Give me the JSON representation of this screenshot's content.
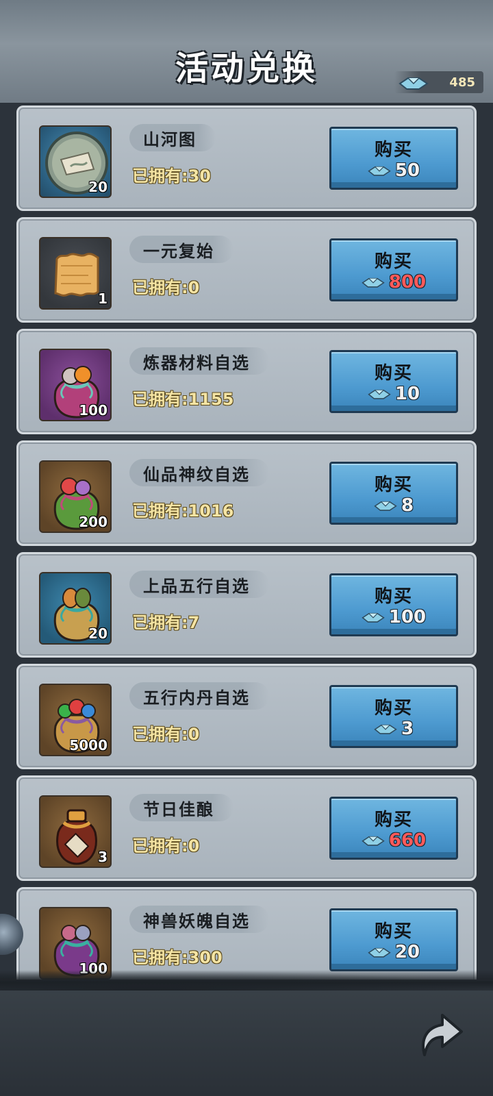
{
  "header": {
    "title": "活动兑换",
    "currency_icon": "gem-boat-icon",
    "currency_value": "485"
  },
  "buy_label": "购买",
  "items": [
    {
      "name": "山河图",
      "owned": "已拥有:30",
      "count": "20",
      "price": "50",
      "price_color": "#f2f2f2",
      "icon": "scroll-orb-icon",
      "frame": "blue"
    },
    {
      "name": "一元复始",
      "owned": "已拥有:0",
      "count": "1",
      "price": "800",
      "price_color": "#ff5a5a",
      "icon": "parchment-icon",
      "frame": "dark"
    },
    {
      "name": "炼器材料自选",
      "owned": "已拥有:1155",
      "count": "100",
      "price": "10",
      "price_color": "#f2f2f2",
      "icon": "purple-bag-icon",
      "frame": "purple"
    },
    {
      "name": "仙品神纹自选",
      "owned": "已拥有:1016",
      "count": "200",
      "price": "8",
      "price_color": "#f2f2f2",
      "icon": "green-bag-icon",
      "frame": "brown"
    },
    {
      "name": "上品五行自选",
      "owned": "已拥有:7",
      "count": "20",
      "price": "100",
      "price_color": "#f2f2f2",
      "icon": "teal-bag-icon",
      "frame": "teal"
    },
    {
      "name": "五行内丹自选",
      "owned": "已拥有:0",
      "count": "5000",
      "price": "3",
      "price_color": "#f2f2f2",
      "icon": "orb-bag-icon",
      "frame": "brown"
    },
    {
      "name": "节日佳酿",
      "owned": "已拥有:0",
      "count": "3",
      "price": "660",
      "price_color": "#ff5a5a",
      "icon": "wine-jar-icon",
      "frame": "brown"
    },
    {
      "name": "神兽妖魄自选",
      "owned": "已拥有:300",
      "count": "100",
      "price": "20",
      "price_color": "#f2f2f2",
      "icon": "soul-bag-icon",
      "frame": "brown"
    }
  ],
  "footer": {
    "back_icon": "return-arrow-icon"
  }
}
